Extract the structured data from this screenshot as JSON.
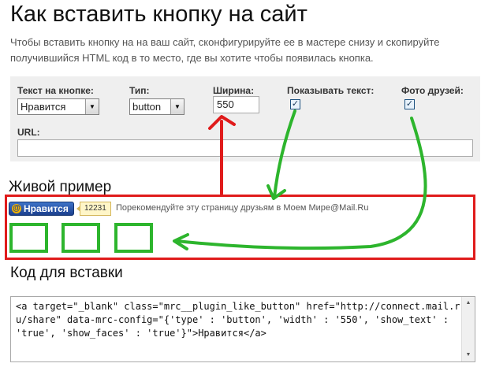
{
  "page": {
    "title": "Как вставить кнопку на сайт",
    "intro": "Чтобы вставить кнопку на на ваш сайт, сконфигурируйте ее в мастере снизу и скопируйте получившийся HTML код в то место, где вы хотите чтобы появилась кнопка."
  },
  "config": {
    "button_text_label": "Текст на кнопке:",
    "button_text_value": "Нравится",
    "type_label": "Тип:",
    "type_value": "button",
    "width_label": "Ширина:",
    "width_value": "550",
    "show_text_label": "Показывать текст:",
    "show_text_checked": "✓",
    "friends_photo_label": "Фото друзей:",
    "friends_photo_checked": "✓",
    "url_label": "URL:",
    "url_value": ""
  },
  "live": {
    "heading": "Живой пример",
    "button_label": "Нравится",
    "count": "12231",
    "recommend_text": "Порекомендуйте эту страницу друзьям в Моем Мире@Mail.Ru"
  },
  "code": {
    "heading": "Код для вставки",
    "snippet": "<a target=\"_blank\" class=\"mrc__plugin_like_button\" href=\"http://connect.mail.ru/share\" data-mrc-config=\"{'type' : 'button', 'width' : '550', 'show_text' : 'true', 'show_faces' : 'true'}\">Нравится</a>"
  },
  "colors": {
    "annotation_red": "#e01b1b",
    "annotation_green": "#2db52d",
    "button_blue": "#1b3f8d"
  },
  "icons": {
    "like_button_icon": "at-sign-icon",
    "select_arrow": "chevron-down-icon"
  }
}
